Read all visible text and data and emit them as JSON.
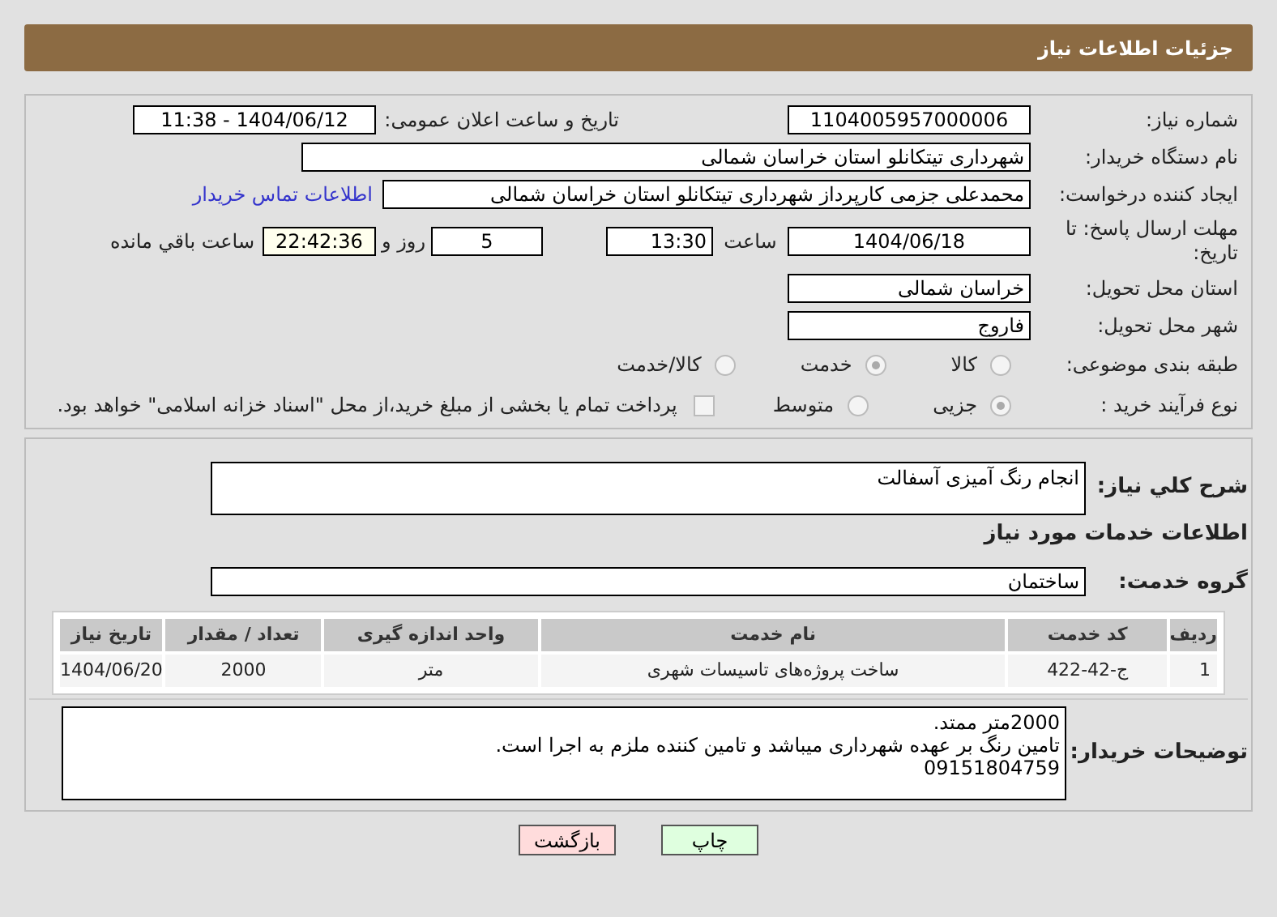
{
  "header": {
    "title": "جزئیات اطلاعات نیاز"
  },
  "details": {
    "need_number": {
      "label": "شماره نیاز:",
      "value": "1104005957000006"
    },
    "announce": {
      "label": "تاریخ و ساعت اعلان عمومی:",
      "value": "1404/06/12 - 11:38"
    },
    "buyer": {
      "label": "نام دستگاه خریدار:",
      "value": "شهرداری تیتکانلو استان خراسان شمالی"
    },
    "creator": {
      "label": "ایجاد کننده درخواست:",
      "value": "محمدعلی جزمی کارپرداز شهرداری تیتکانلو استان خراسان شمالی",
      "link": "اطلاعات تماس خریدار"
    },
    "deadline": {
      "label": "مهلت ارسال پاسخ: تا تاریخ:",
      "date": "1404/06/18",
      "time_label": "ساعت",
      "time": "13:30",
      "days": "5",
      "days_label": "روز و",
      "remaining": "22:42:36",
      "remaining_label": "ساعت باقي مانده"
    },
    "province": {
      "label": "استان محل تحویل:",
      "value": "خراسان شمالی"
    },
    "city": {
      "label": "شهر محل تحویل:",
      "value": "فاروج"
    },
    "category": {
      "label": "طبقه بندی موضوعی:",
      "options": [
        {
          "label": "کالا",
          "selected": false
        },
        {
          "label": "خدمت",
          "selected": true
        },
        {
          "label": "کالا/خدمت",
          "selected": false
        }
      ]
    },
    "process": {
      "label": "نوع فرآیند خرید :",
      "options": [
        {
          "label": "جزیی",
          "selected": true
        },
        {
          "label": "متوسط",
          "selected": false
        }
      ],
      "payment": {
        "checked": false,
        "label": "پرداخت تمام یا بخشی از مبلغ خرید،از محل \"اسناد خزانه اسلامی\" خواهد بود."
      }
    }
  },
  "services": {
    "summary": {
      "label": "شرح کلي نياز:",
      "value": "انجام رنگ آمیزی آسفالت"
    },
    "heading": "اطلاعات خدمات مورد نياز",
    "group": {
      "label": "گروه خدمت:",
      "value": "ساختمان"
    },
    "table": {
      "columns": [
        "رديف",
        "کد خدمت",
        "نام خدمت",
        "واحد اندازه گیری",
        "تعداد / مقدار",
        "تاریخ نیاز"
      ],
      "rows": [
        [
          "1",
          "ج-42-422",
          "ساخت پروژه‌های تاسیسات شهری",
          "متر",
          "2000",
          "1404/06/20"
        ]
      ]
    },
    "notes": {
      "label": "توضیحات خریدار:",
      "lines": [
        "2000متر ممتد.",
        "تامین رنگ بر عهده شهرداری میباشد و تامین کننده ملزم به اجرا است.",
        "09151804759"
      ]
    }
  },
  "buttons": [
    {
      "label": "چاپ",
      "kind": "print"
    },
    {
      "label": "بازگشت",
      "kind": "back"
    }
  ]
}
